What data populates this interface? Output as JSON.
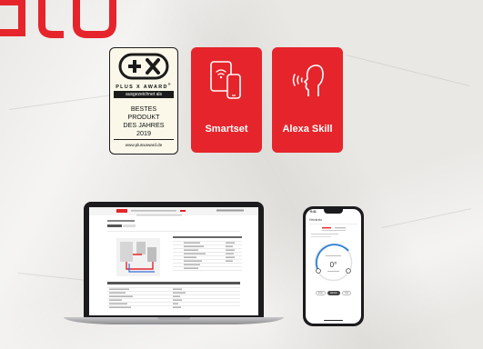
{
  "colors": {
    "brand_red": "#e5252b",
    "award_bg": "#fbf8ea",
    "ink": "#1b1b1b"
  },
  "award": {
    "logo_icon": "plus-x-icon",
    "name": "PLUS X AWARD",
    "registered": "®",
    "band_text": "ausgezeichnet als",
    "title_lines": [
      "BESTES",
      "PRODUKT",
      "DES JAHRES",
      "2019"
    ],
    "url": "www.plusxaward.de"
  },
  "tiles": [
    {
      "label": "Smartset",
      "icon": "tablet-phone-icon"
    },
    {
      "label": "Alexa Skill",
      "icon": "voice-head-icon"
    }
  ],
  "laptop_screen": {
    "icon": "heating-app-web-screen"
  },
  "phone_screen": {
    "status_time": "9:41",
    "header": "Heizkreis",
    "temperature": "0°",
    "chips": [
      "Auto",
      "Heizen",
      "Aus"
    ]
  }
}
